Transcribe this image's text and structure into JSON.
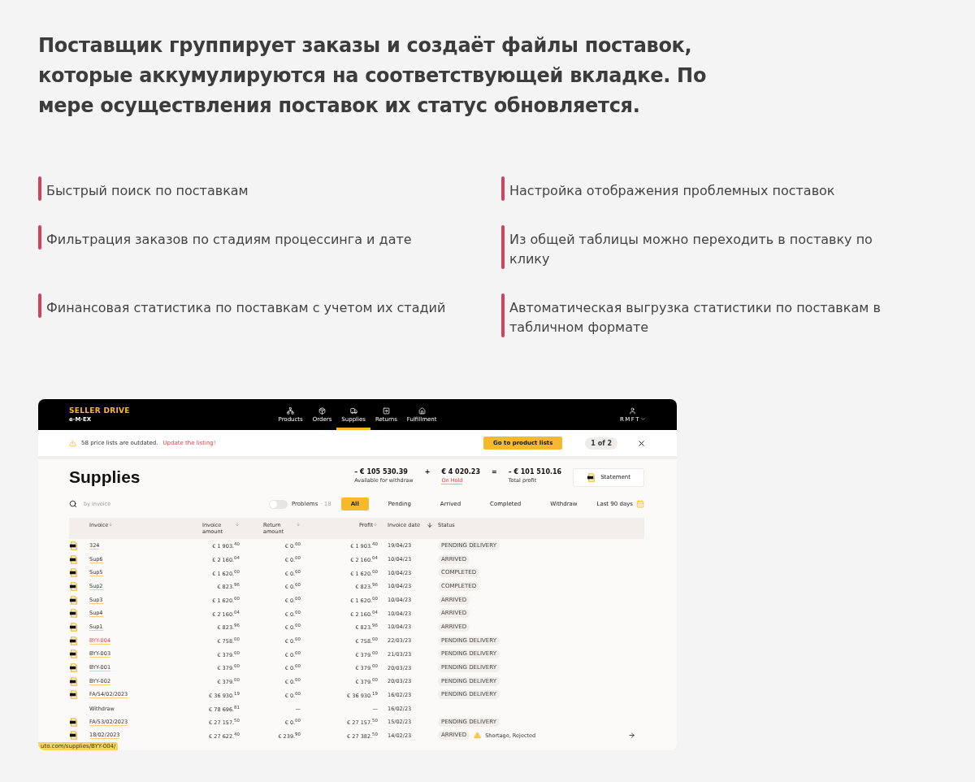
{
  "heading": "Поставщик группирует заказы и создаёт файлы поставок, которые аккумулируются на соответствующей вкладке. По мере осуществления поставок их статус обновляется.",
  "features": [
    {
      "text": "Быстрый поиск по поставкам"
    },
    {
      "text": "Настройка отображения проблемных поставок"
    },
    {
      "text": "Фильтрация заказов по стадиям процессинга и дате"
    },
    {
      "text": "Из общей таблицы можно переходить в поставку по клику"
    },
    {
      "text": "Финансовая статистика по поставкам с учетом их стадий"
    },
    {
      "text": "Автоматическая выгрузка статистики по поставкам в табличном формате"
    }
  ],
  "app": {
    "brand": "SELLER DRIVE",
    "logo": "e·M·EX",
    "nav": [
      {
        "label": "Products",
        "kind": "products",
        "selected": false
      },
      {
        "label": "Orders",
        "kind": "orders",
        "selected": false
      },
      {
        "label": "Supplies",
        "kind": "supplies",
        "selected": true
      },
      {
        "label": "Returns",
        "kind": "returns",
        "selected": false
      },
      {
        "label": "Fulfillment",
        "kind": "fulfillment",
        "selected": false
      }
    ],
    "user": "RMFT",
    "alert": {
      "text": "58 price lists are outdated.",
      "link": "Update the listing!",
      "button": "Go to product lists",
      "pager": "1 of 2"
    },
    "title": "Supplies",
    "summary": [
      {
        "value": "– € 105 530.39",
        "label": "Available for withdraw",
        "kind": "plain"
      },
      {
        "value": "€ 4 020.23",
        "label": "On Hold",
        "kind": "alert"
      },
      {
        "value": "– € 101 510.16",
        "label": "Total profit",
        "kind": "plain"
      }
    ],
    "operators": [
      "+",
      "="
    ],
    "statement": "Statement",
    "search": {
      "placeholder": "by invoice"
    },
    "problems": {
      "label": "Problems",
      "count": "· 18",
      "on": false
    },
    "filters": [
      {
        "label": "All",
        "selected": true
      },
      {
        "label": "Pending",
        "selected": false
      },
      {
        "label": "Arrived",
        "selected": false
      },
      {
        "label": "Completed",
        "selected": false
      },
      {
        "label": "Withdraw",
        "selected": false
      }
    ],
    "period": "Last 90 days",
    "columns": [
      {
        "label": "Invoice"
      },
      {
        "label": "Invoice amount"
      },
      {
        "label": "Return amount"
      },
      {
        "label": "Profit"
      },
      {
        "label": "Invoice date"
      },
      {
        "label": "Status"
      }
    ],
    "rows": [
      {
        "kind": "supply",
        "invoice": "324",
        "amount": "€ 1 903.$^{40}$",
        "return": "€ 0.$^{00}$",
        "profit": "€ 1 903.$^{40}$",
        "date": "19/04/23",
        "status": "PENDING DELIVERY",
        "highlighted": false
      },
      {
        "kind": "supply",
        "invoice": "Sup6",
        "amount": "€ 2 160.$^{04}$",
        "return": "€ 0.$^{00}$",
        "profit": "€ 2 160.$^{04}$",
        "date": "10/04/23",
        "status": "ARRIVED",
        "highlighted": false
      },
      {
        "kind": "supply",
        "invoice": "Sup5",
        "amount": "€ 1 620.$^{00}$",
        "return": "€ 0.$^{00}$",
        "profit": "€ 1 620.$^{00}$",
        "date": "10/04/23",
        "status": "COMPLETED",
        "highlighted": false
      },
      {
        "kind": "supply",
        "invoice": "Sup2",
        "amount": "€ 823.$^{96}$",
        "return": "€ 0.$^{00}$",
        "profit": "€ 823.$^{96}$",
        "date": "10/04/23",
        "status": "COMPLETED",
        "highlighted": false
      },
      {
        "kind": "supply",
        "invoice": "Sup3",
        "amount": "€ 1 620.$^{00}$",
        "return": "€ 0.$^{00}$",
        "profit": "€ 1 620.$^{00}$",
        "date": "10/04/23",
        "status": "ARRIVED",
        "highlighted": false
      },
      {
        "kind": "supply",
        "invoice": "Sup4",
        "amount": "€ 2 160.$^{04}$",
        "return": "€ 0.$^{00}$",
        "profit": "€ 2 160.$^{04}$",
        "date": "10/04/23",
        "status": "ARRIVED",
        "highlighted": false
      },
      {
        "kind": "supply",
        "invoice": "Sup1",
        "amount": "€ 823.$^{96}$",
        "return": "€ 0.$^{00}$",
        "profit": "€ 823.$^{96}$",
        "date": "10/04/23",
        "status": "ARRIVED",
        "highlighted": false
      },
      {
        "kind": "supply",
        "invoice": "BYY-004",
        "amount": "€ 758.$^{00}$",
        "return": "€ 0.$^{00}$",
        "profit": "€ 758.$^{00}$",
        "date": "22/03/23",
        "status": "PENDING DELIVERY",
        "highlighted": true
      },
      {
        "kind": "supply",
        "invoice": "BYY-003",
        "amount": "€ 379.$^{00}$",
        "return": "€ 0.$^{00}$",
        "profit": "€ 379.$^{00}$",
        "date": "21/03/23",
        "status": "PENDING DELIVERY",
        "highlighted": false
      },
      {
        "kind": "supply",
        "invoice": "BYY-001",
        "amount": "€ 379.$^{00}$",
        "return": "€ 0.$^{00}$",
        "profit": "€ 379.$^{00}$",
        "date": "20/03/23",
        "status": "PENDING DELIVERY",
        "highlighted": false
      },
      {
        "kind": "supply",
        "invoice": "BYY-002",
        "amount": "€ 379.$^{00}$",
        "return": "€ 0.$^{00}$",
        "profit": "€ 379.$^{00}$",
        "date": "20/03/23",
        "status": "PENDING DELIVERY",
        "highlighted": false
      },
      {
        "kind": "supply",
        "invoice": "FA/54/02/2023",
        "amount": "€ 36 930.$^{19}$",
        "return": "€ 0.$^{00}$",
        "profit": "€ 36 930.$^{19}$",
        "date": "16/02/23",
        "status": "PENDING DELIVERY",
        "highlighted": false
      },
      {
        "kind": "withdraw",
        "invoice": "Withdraw",
        "amount": "€ 78 696.$^{81}$",
        "return": "—",
        "profit": "—",
        "date": "16/02/23",
        "highlighted": false
      },
      {
        "kind": "supply",
        "invoice": "FA/53/02/2023",
        "amount": "€ 27 157.$^{50}$",
        "return": "€ 0.$^{00}$",
        "profit": "€ 27 157.$^{50}$",
        "date": "15/02/23",
        "status": "PENDING DELIVERY",
        "highlighted": false
      },
      {
        "kind": "supply",
        "invoice": "18/02/2023",
        "amount": "€ 27 622.$^{40}$",
        "return": "€ 239.$^{90}$",
        "profit": "€ 27 382.$^{50}$",
        "date": "14/02/23",
        "status": "ARRIVED",
        "problem": "Shortage, Rejected",
        "highlighted": false
      }
    ],
    "link_preview": "uto.com/supplies/BYY-004/"
  }
}
